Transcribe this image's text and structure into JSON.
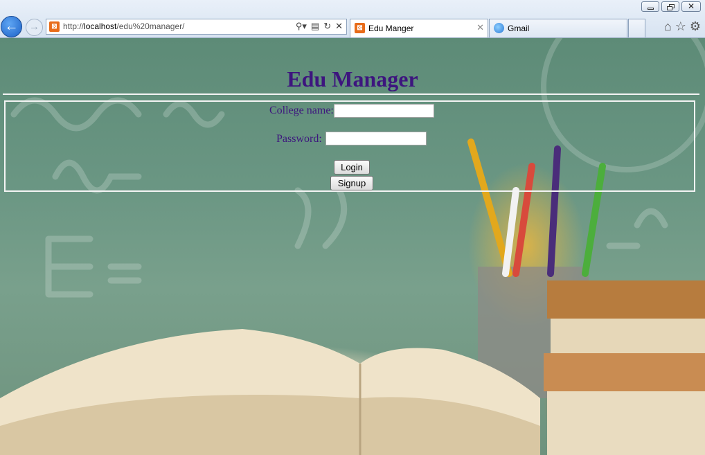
{
  "browser": {
    "url_prefix": "http://",
    "url_host": "localhost",
    "url_path": "/edu%20manager/",
    "tabs": [
      {
        "label": "Edu Manger",
        "active": true
      },
      {
        "label": "Gmail",
        "active": false
      }
    ]
  },
  "page": {
    "title": "Edu Manager",
    "form": {
      "college_name_label": "College name:",
      "college_name_value": "",
      "password_label": "Password:",
      "password_value": "",
      "login_label": "Login",
      "signup_label": "Signup"
    }
  },
  "colors": {
    "heading": "#3d157e",
    "form_border": "#f4f4f4"
  }
}
